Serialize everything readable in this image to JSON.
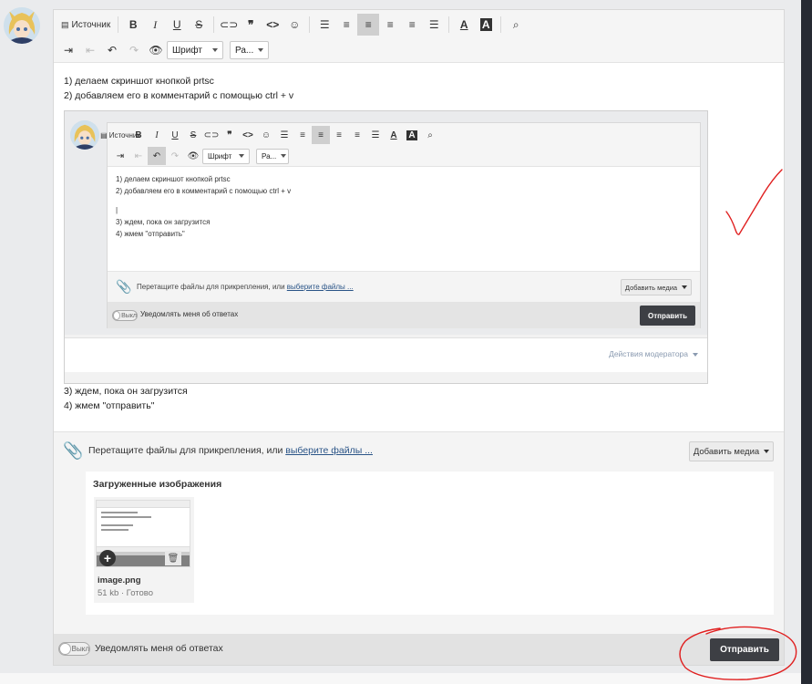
{
  "toolbar": {
    "source_label": "Источник",
    "font_select": "Шрифт",
    "size_select": "Ра..."
  },
  "content": {
    "line1": "1) делаем скриншот кнопкой prtsc",
    "line2": "2) добавляем его в комментарий с помощью ctrl + v",
    "line3": "3) ждем, пока он загрузится",
    "line4": "4) жмем \"отправить\""
  },
  "inner": {
    "lines": [
      "1) делаем скриншот кнопкой prtsc",
      "2) добавляем его в комментарий с помощью ctrl + v",
      "|",
      "3) ждем, пока он загрузится",
      "4) жмем \"отправить\""
    ],
    "attach_text": "Перетащите файлы для прикрепления, или ",
    "attach_link": "выберите файлы ...",
    "media_button": "Добавить медиа",
    "toggle_label": "Выкл",
    "notify_label": "Уведомлять меня об ответах",
    "send_button": "Отправить",
    "moderator_actions": "Действия модератора"
  },
  "attach": {
    "text": "Перетащите файлы для прикрепления, или ",
    "link": "выберите файлы ...",
    "media_button": "Добавить медиа"
  },
  "uploaded": {
    "title": "Загруженные изображения",
    "file_name": "image.png",
    "file_meta": "51 kb · Готово"
  },
  "footer": {
    "toggle_label": "Выкл",
    "notify_label": "Уведомлять меня об ответах",
    "send_button": "Отправить"
  },
  "colors": {
    "annotation": "#e02020",
    "send_button": "#3d3f44",
    "link": "#2a5487"
  }
}
